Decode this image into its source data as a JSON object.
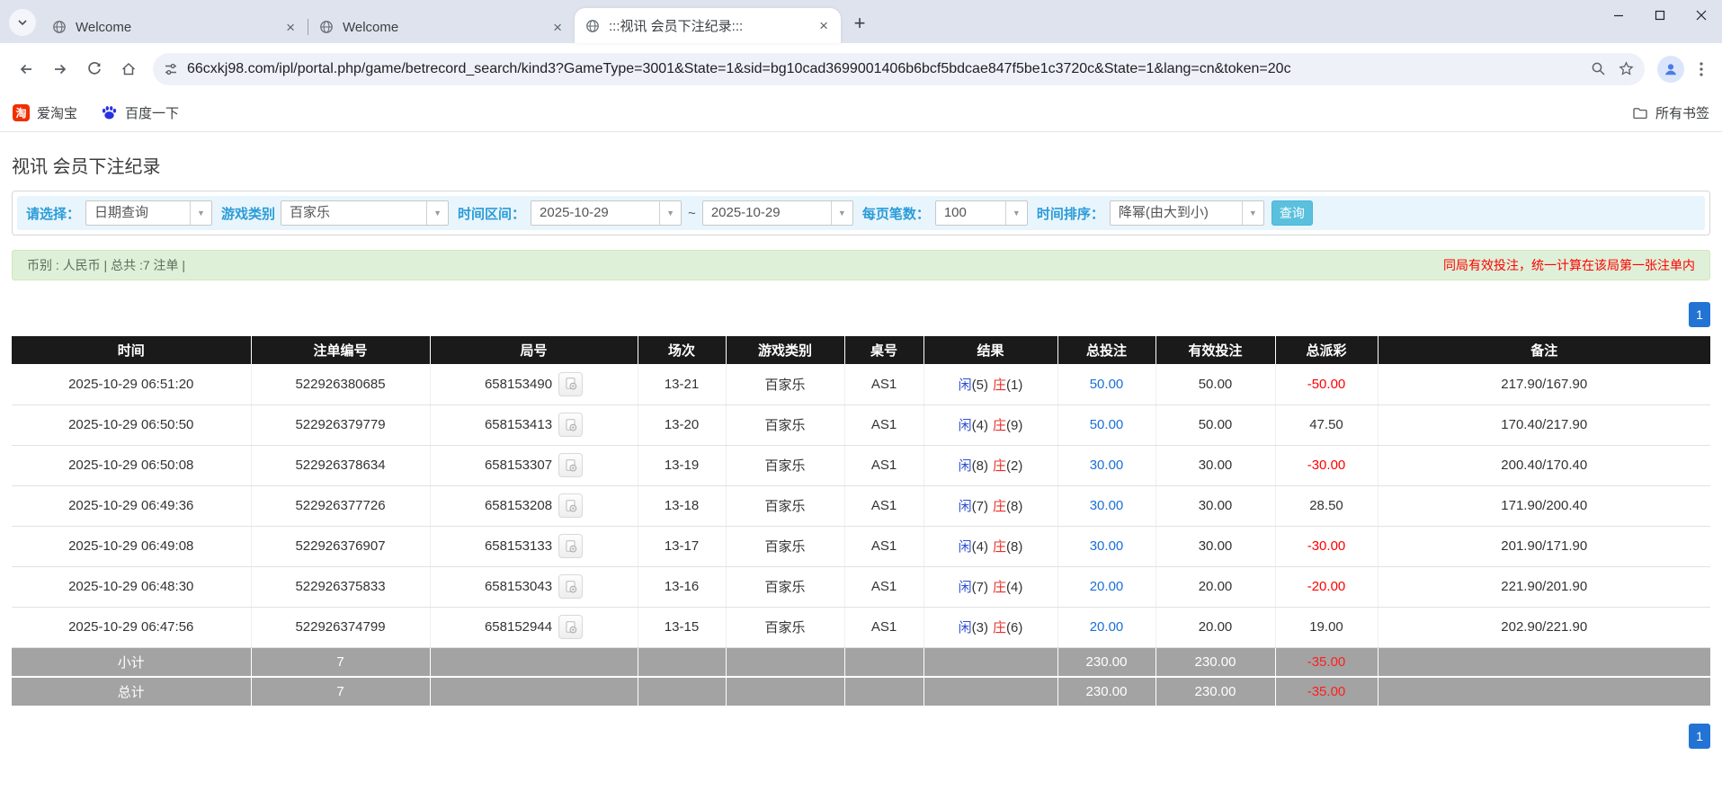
{
  "browser": {
    "tabs": [
      {
        "title": "Welcome"
      },
      {
        "title": "Welcome"
      },
      {
        "title": ":::视讯 会员下注纪录:::"
      }
    ],
    "url": "66cxkj98.com/ipl/portal.php/game/betrecord_search/kind3?GameType=3001&State=1&sid=bg10cad3699001406b6bcf5bdcae847f5be1c3720c&State=1&lang=cn&token=20c",
    "bookmarks": {
      "items": [
        "爱淘宝",
        "百度一下"
      ],
      "taobao_glyph": "淘",
      "all_label": "所有书签"
    }
  },
  "page": {
    "title": "视讯 会员下注纪录",
    "filters": {
      "select_label": "请选择：",
      "select_value": "日期查询",
      "game_type_label": "游戏类别",
      "game_type_value": "百家乐",
      "time_range_label": "时间区间：",
      "date_from": "2025-10-29",
      "tilde": "~",
      "date_to": "2025-10-29",
      "page_size_label": "每页笔数：",
      "page_size_value": "100",
      "sort_label": "时间排序：",
      "sort_value": "降幂(由大到小)",
      "search_button": "查询"
    },
    "summary": {
      "left": "币别 : 人民币 | 总共 :7 注单 |",
      "right": "同局有效投注，统一计算在该局第一张注单内"
    },
    "pagination": {
      "page": "1"
    },
    "table": {
      "headers": [
        "时间",
        "注单编号",
        "局号",
        "场次",
        "游戏类别",
        "桌号",
        "结果",
        "总投注",
        "有效投注",
        "总派彩",
        "备注"
      ],
      "rows": [
        {
          "time": "2025-10-29 06:51:20",
          "bet_id": "522926380685",
          "round_id": "658153490",
          "session": "13-21",
          "game": "百家乐",
          "table_no": "AS1",
          "result_xian": "闲",
          "result_xian_n": "(5)",
          "result_zhuang": "庄",
          "result_zhuang_n": "(1)",
          "total_bet": "50.00",
          "valid_bet": "50.00",
          "payout": "-50.00",
          "note": "217.90/167.90"
        },
        {
          "time": "2025-10-29 06:50:50",
          "bet_id": "522926379779",
          "round_id": "658153413",
          "session": "13-20",
          "game": "百家乐",
          "table_no": "AS1",
          "result_xian": "闲",
          "result_xian_n": "(4)",
          "result_zhuang": "庄",
          "result_zhuang_n": "(9)",
          "total_bet": "50.00",
          "valid_bet": "50.00",
          "payout": "47.50",
          "note": "170.40/217.90"
        },
        {
          "time": "2025-10-29 06:50:08",
          "bet_id": "522926378634",
          "round_id": "658153307",
          "session": "13-19",
          "game": "百家乐",
          "table_no": "AS1",
          "result_xian": "闲",
          "result_xian_n": "(8)",
          "result_zhuang": "庄",
          "result_zhuang_n": "(2)",
          "total_bet": "30.00",
          "valid_bet": "30.00",
          "payout": "-30.00",
          "note": "200.40/170.40"
        },
        {
          "time": "2025-10-29 06:49:36",
          "bet_id": "522926377726",
          "round_id": "658153208",
          "session": "13-18",
          "game": "百家乐",
          "table_no": "AS1",
          "result_xian": "闲",
          "result_xian_n": "(7)",
          "result_zhuang": "庄",
          "result_zhuang_n": "(8)",
          "total_bet": "30.00",
          "valid_bet": "30.00",
          "payout": "28.50",
          "note": "171.90/200.40"
        },
        {
          "time": "2025-10-29 06:49:08",
          "bet_id": "522926376907",
          "round_id": "658153133",
          "session": "13-17",
          "game": "百家乐",
          "table_no": "AS1",
          "result_xian": "闲",
          "result_xian_n": "(4)",
          "result_zhuang": "庄",
          "result_zhuang_n": "(8)",
          "total_bet": "30.00",
          "valid_bet": "30.00",
          "payout": "-30.00",
          "note": "201.90/171.90"
        },
        {
          "time": "2025-10-29 06:48:30",
          "bet_id": "522926375833",
          "round_id": "658153043",
          "session": "13-16",
          "game": "百家乐",
          "table_no": "AS1",
          "result_xian": "闲",
          "result_xian_n": "(7)",
          "result_zhuang": "庄",
          "result_zhuang_n": "(4)",
          "total_bet": "20.00",
          "valid_bet": "20.00",
          "payout": "-20.00",
          "note": "221.90/201.90"
        },
        {
          "time": "2025-10-29 06:47:56",
          "bet_id": "522926374799",
          "round_id": "658152944",
          "session": "13-15",
          "game": "百家乐",
          "table_no": "AS1",
          "result_xian": "闲",
          "result_xian_n": "(3)",
          "result_zhuang": "庄",
          "result_zhuang_n": "(6)",
          "total_bet": "20.00",
          "valid_bet": "20.00",
          "payout": "19.00",
          "note": "202.90/221.90"
        }
      ],
      "subtotal": {
        "label": "小计",
        "count": "7",
        "total_bet": "230.00",
        "valid_bet": "230.00",
        "payout": "-35.00"
      },
      "total": {
        "label": "总计",
        "count": "7",
        "total_bet": "230.00",
        "valid_bet": "230.00",
        "payout": "-35.00"
      }
    }
  },
  "colors": {
    "filter_label_blue": "#2b9cd8",
    "search_button_blue": "#5bc0de",
    "summary_bar_green": "#dff0d8",
    "notice_red": "#ff0000",
    "amount_link_blue": "#1a6fd8",
    "player_blue": "#2f4fd0",
    "banker_red": "#e8302a",
    "pagination_blue": "#2273d4",
    "table_header_black": "#1a1a1a",
    "sum_row_gray": "#a3a3a3"
  }
}
